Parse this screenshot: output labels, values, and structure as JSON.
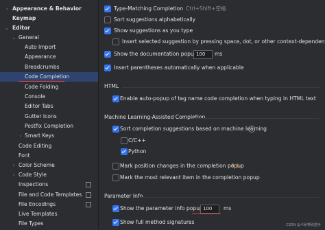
{
  "sidebar": {
    "appearance": "Appearance & Behavior",
    "keymap": "Keymap",
    "editor": "Editor",
    "general": "General",
    "auto_import": "Auto Import",
    "appearance_sub": "Appearance",
    "breadcrumbs": "Breadcrumbs",
    "code_completion": "Code Completion",
    "code_folding": "Code Folding",
    "console": "Console",
    "editor_tabs": "Editor Tabs",
    "gutter_icons": "Gutter Icons",
    "postfix": "Postfix Completion",
    "smart_keys": "Smart Keys",
    "code_editing": "Code Editing",
    "font": "Font",
    "color_scheme": "Color Scheme",
    "code_style": "Code Style",
    "inspections": "Inspections",
    "file_code_templates": "File and Code Templates",
    "file_encodings": "File Encodings",
    "live_templates": "Live Templates",
    "file_types": "File Types"
  },
  "content": {
    "type_matching": "Type-Matching Completion",
    "type_matching_shortcut": "Ctrl+Shift+空格",
    "sort_alpha": "Sort suggestions alphabetically",
    "show_as_type": "Show suggestions as you type",
    "insert_selected": "Insert selected suggestion by pressing space, dot, or other context-dependent keys",
    "show_doc_popup": "Show the documentation popup in",
    "doc_ms_value": "100",
    "ms": "ms",
    "insert_parens": "Insert parentheses automatically when applicable",
    "html_section": "HTML",
    "html_autopopup": "Enable auto-popup of tag name code completion when typing in HTML text",
    "ml_section": "Machine Learning-Assisted Completion",
    "ml_sort": "Sort completion suggestions based on machine learning",
    "help_glyph": "?",
    "cpp": "C/C++",
    "python": "Python",
    "mark_position": "Mark position changes in the completion popup",
    "mark_relevant": "Mark the most relevant item in the completion popup",
    "param_section": "Parameter Info",
    "show_param_popup": "Show the parameter info popup in",
    "param_ms_value": "100",
    "show_full_sig": "Show full method signatures"
  },
  "watermark": "CSDN @卡秋特别选手",
  "colors": {
    "background": "#2b2d30",
    "selection": "#2e436e",
    "checkbox_accent": "#3574f0",
    "underline_red": "#e04343"
  }
}
